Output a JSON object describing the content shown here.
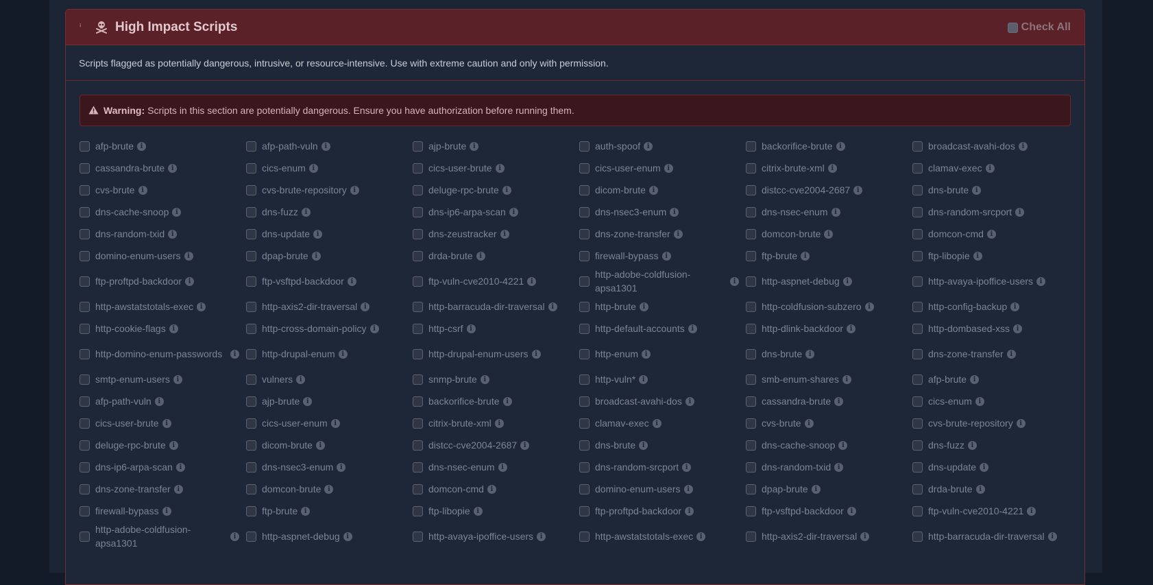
{
  "panel": {
    "collapse_mark": "ⁱ",
    "title": "High Impact Scripts",
    "check_all_label": "Check All",
    "description": "Scripts flagged as potentially dangerous, intrusive, or resource-intensive. Use with extreme caution and only with permission.",
    "warning_bold": "Warning:",
    "warning_text": "Scripts in this section are potentially dangerous. Ensure you have authorization before running them."
  },
  "colors": {
    "header_bg": "#5a2129",
    "border": "#7a2b33",
    "warning_bg": "#3a161d"
  },
  "scripts": [
    "afp-brute",
    "afp-path-vuln",
    "ajp-brute",
    "auth-spoof",
    "backorifice-brute",
    "broadcast-avahi-dos",
    "cassandra-brute",
    "cics-enum",
    "cics-user-brute",
    "cics-user-enum",
    "citrix-brute-xml",
    "clamav-exec",
    "cvs-brute",
    "cvs-brute-repository",
    "deluge-rpc-brute",
    "dicom-brute",
    "distcc-cve2004-2687",
    "dns-brute",
    "dns-cache-snoop",
    "dns-fuzz",
    "dns-ip6-arpa-scan",
    "dns-nsec3-enum",
    "dns-nsec-enum",
    "dns-random-srcport",
    "dns-random-txid",
    "dns-update",
    "dns-zeustracker",
    "dns-zone-transfer",
    "domcon-brute",
    "domcon-cmd",
    "domino-enum-users",
    "dpap-brute",
    "drda-brute",
    "firewall-bypass",
    "ftp-brute",
    "ftp-libopie",
    "ftp-proftpd-backdoor",
    "ftp-vsftpd-backdoor",
    "ftp-vuln-cve2010-4221",
    "http-adobe-coldfusion-apsa1301",
    "http-aspnet-debug",
    "http-avaya-ipoffice-users",
    "http-awstatstotals-exec",
    "http-axis2-dir-traversal",
    "http-barracuda-dir-traversal",
    "http-brute",
    "http-coldfusion-subzero",
    "http-config-backup",
    "http-cookie-flags",
    "http-cross-domain-policy",
    "http-csrf",
    "http-default-accounts",
    "http-dlink-backdoor",
    "http-dombased-xss",
    "http-domino-enum-passwords",
    "http-drupal-enum",
    "http-drupal-enum-users",
    "http-enum",
    "dns-brute",
    "dns-zone-transfer",
    "smtp-enum-users",
    "vulners",
    "snmp-brute",
    "http-vuln*",
    "smb-enum-shares",
    "afp-brute",
    "afp-path-vuln",
    "ajp-brute",
    "backorifice-brute",
    "broadcast-avahi-dos",
    "cassandra-brute",
    "cics-enum",
    "cics-user-brute",
    "cics-user-enum",
    "citrix-brute-xml",
    "clamav-exec",
    "cvs-brute",
    "cvs-brute-repository",
    "deluge-rpc-brute",
    "dicom-brute",
    "distcc-cve2004-2687",
    "dns-brute",
    "dns-cache-snoop",
    "dns-fuzz",
    "dns-ip6-arpa-scan",
    "dns-nsec3-enum",
    "dns-nsec-enum",
    "dns-random-srcport",
    "dns-random-txid",
    "dns-update",
    "dns-zone-transfer",
    "domcon-brute",
    "domcon-cmd",
    "domino-enum-users",
    "dpap-brute",
    "drda-brute",
    "firewall-bypass",
    "ftp-brute",
    "ftp-libopie",
    "ftp-proftpd-backdoor",
    "ftp-vsftpd-backdoor",
    "ftp-vuln-cve2010-4221",
    "http-adobe-coldfusion-apsa1301",
    "http-aspnet-debug",
    "http-avaya-ipoffice-users",
    "http-awstatstotals-exec",
    "http-axis2-dir-traversal",
    "http-barracuda-dir-traversal"
  ],
  "info_glyph": "i"
}
